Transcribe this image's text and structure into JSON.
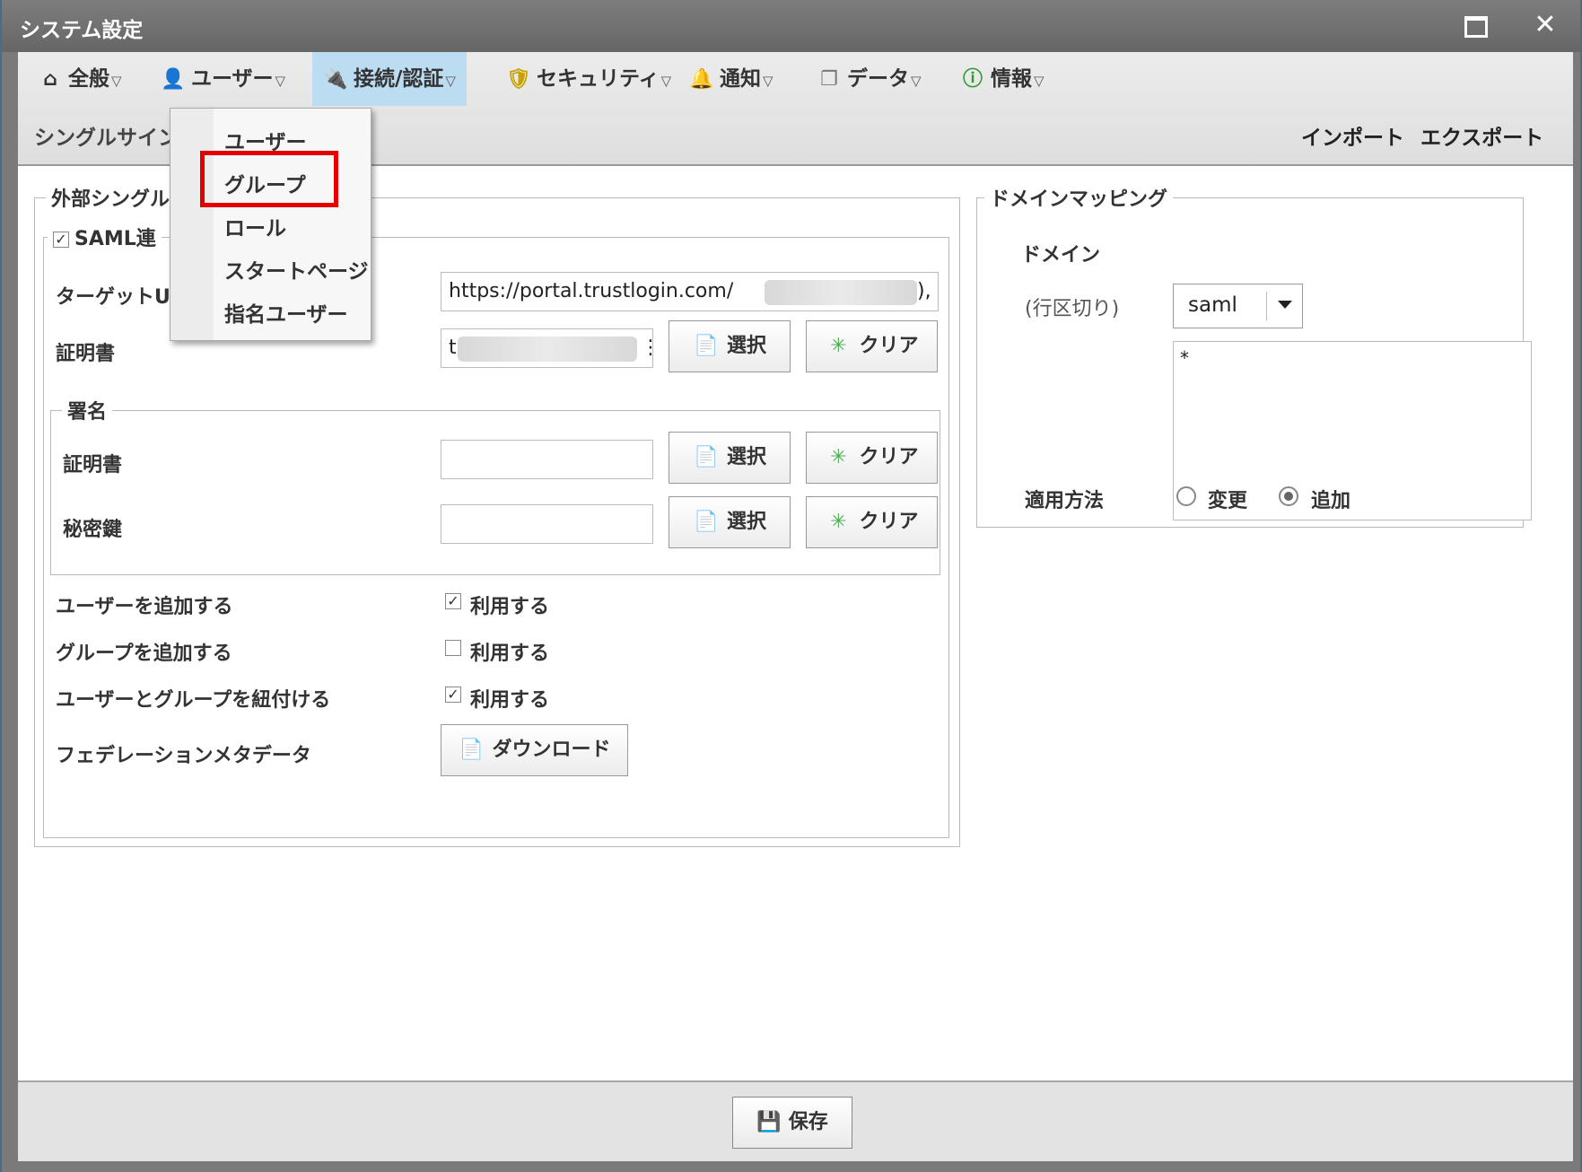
{
  "window": {
    "title": "システム設定",
    "maximize_icon": "maximize-icon",
    "close_glyph": "✕"
  },
  "menubar": {
    "items": [
      {
        "label": "全般",
        "icon": "home-icon",
        "glyph": "⌂"
      },
      {
        "label": "ユーザー",
        "icon": "user-icon",
        "glyph": "👤"
      },
      {
        "label": "接続/認証",
        "icon": "plug-icon",
        "glyph": "🔌"
      },
      {
        "label": "セキュリティ",
        "icon": "shield-icon",
        "glyph": "🛡"
      },
      {
        "label": "通知",
        "icon": "bell-icon",
        "glyph": "🔔"
      },
      {
        "label": "データ",
        "icon": "copy-icon",
        "glyph": "❐"
      },
      {
        "label": "情報",
        "icon": "info-icon",
        "glyph": "ⓘ"
      }
    ],
    "arrow": "▽",
    "submenu_left": "シングルサイン",
    "import_label": "インポート",
    "export_label": "エクスポート"
  },
  "dropdown": {
    "items": [
      "ユーザー",
      "グループ",
      "ロール",
      "スタートページ",
      "指名ユーザー"
    ],
    "highlighted": "グループ"
  },
  "sso": {
    "legend": "外部シングル",
    "saml_legend": "SAML連",
    "saml_checked": true,
    "target_url_label": "ターゲットUF",
    "target_url_value": "https://portal.trustlogin.com/",
    "target_url_tail": "),",
    "cert_label": "証明書",
    "cert_value": "t",
    "cert_tail": "⋮",
    "select_label": "選択",
    "clear_label": "クリア",
    "signature": {
      "legend": "署名",
      "cert_label": "証明書",
      "key_label": "秘密鍵"
    },
    "options": [
      {
        "label": "ユーザーを追加する",
        "check_label": "利用する",
        "checked": true
      },
      {
        "label": "グループを追加する",
        "check_label": "利用する",
        "checked": false
      },
      {
        "label": "ユーザーとグループを紐付ける",
        "check_label": "利用する",
        "checked": true
      }
    ],
    "metadata_label": "フェデレーションメタデータ",
    "download_label": "ダウンロード"
  },
  "domain_mapping": {
    "legend": "ドメインマッピング",
    "domain_label": "ドメイン",
    "domain_value": "saml",
    "lines_label": "(行区切り)",
    "lines_value": "*",
    "apply_label": "適用方法",
    "apply_options": [
      {
        "label": "変更",
        "selected": false
      },
      {
        "label": "追加",
        "selected": true
      }
    ]
  },
  "footer": {
    "save_label": "保存"
  }
}
